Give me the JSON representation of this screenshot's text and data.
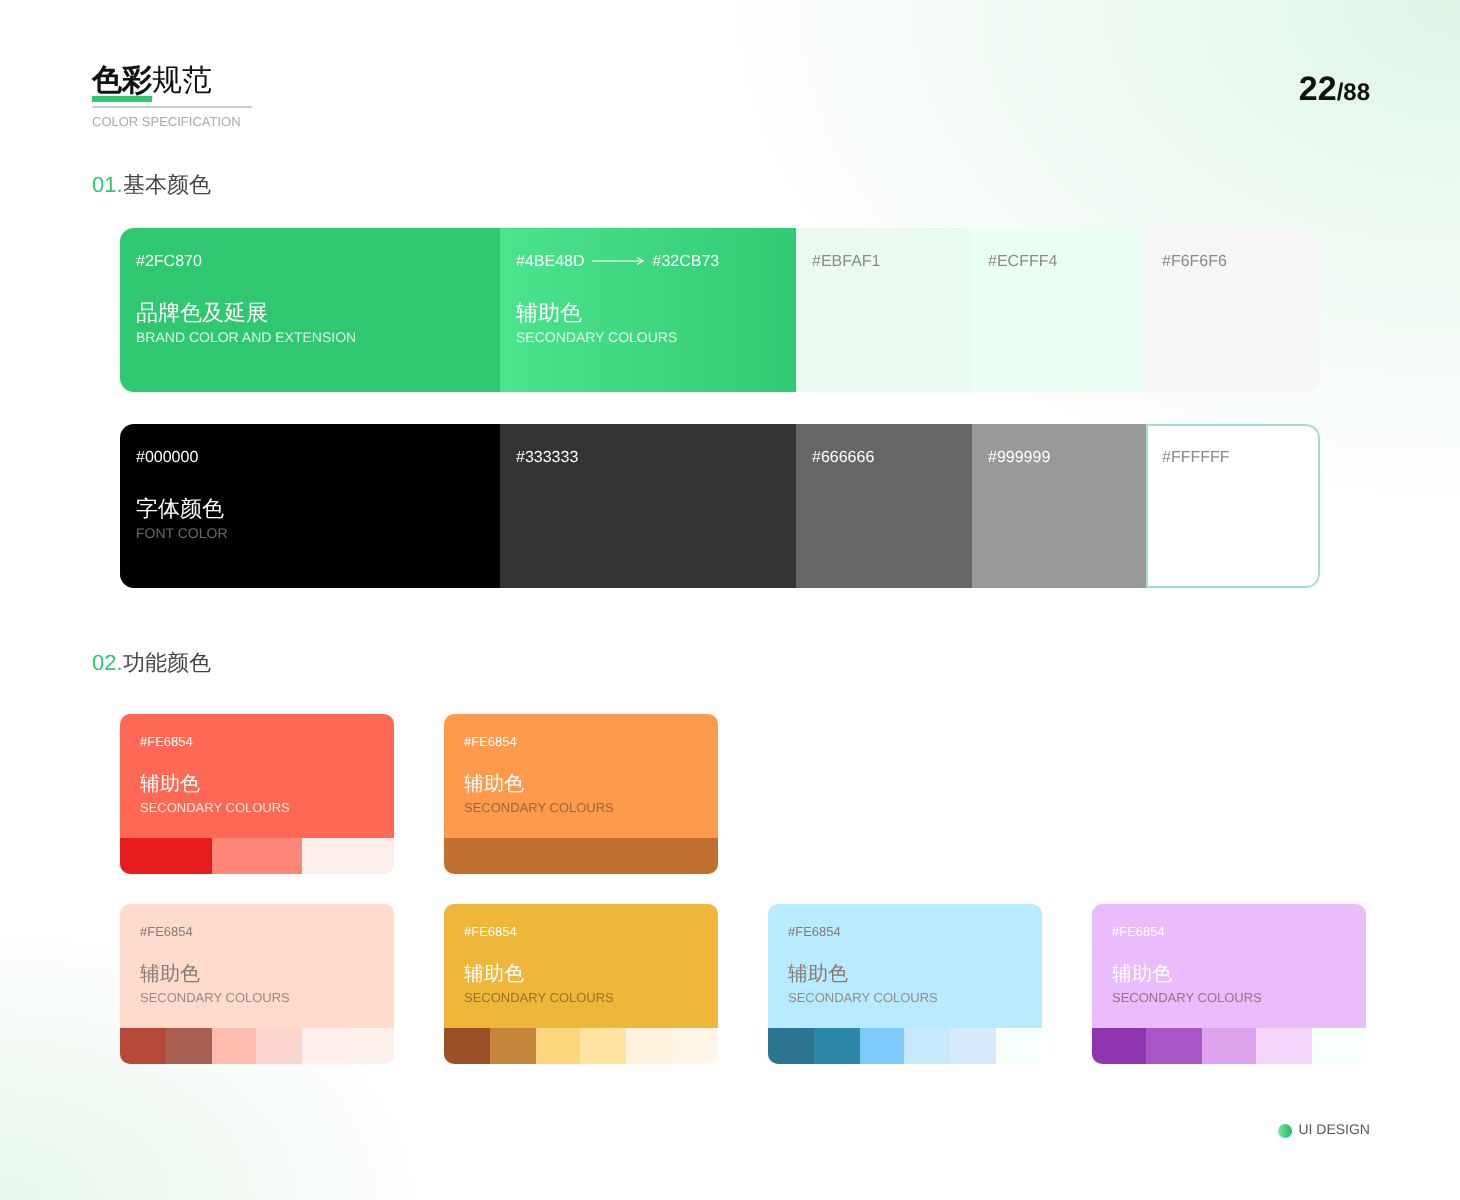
{
  "header": {
    "title_bold": "色彩",
    "title_rest": "规范",
    "subtitle": "COLOR SPECIFICATION",
    "page_current": "22",
    "page_total": "/88"
  },
  "basic": {
    "number": "01.",
    "title": "基本颜色",
    "rows": [
      {
        "segments": [
          {
            "color": "#2FC870",
            "hex": "#2FC870",
            "title": "品牌色及延展",
            "subtitle": "BRAND COLOR AND EXTENSION"
          },
          {
            "color": "#4BE48D",
            "hex": "#4BE48D",
            "hex_to": "#32CB73",
            "title": "辅助色",
            "subtitle": "SECONDARY COLOURS"
          },
          {
            "color": "#EBFAF1",
            "hex": "#EBFAF1"
          },
          {
            "color": "#ECFFF4",
            "hex": "#ECFFF4"
          },
          {
            "color": "#F6F6F6",
            "hex": "#F6F6F6"
          }
        ]
      },
      {
        "segments": [
          {
            "color": "#000000",
            "hex": "#000000",
            "title": "字体颜色",
            "subtitle": "FONT COLOR"
          },
          {
            "color": "#333333",
            "hex": "#333333"
          },
          {
            "color": "#666666",
            "hex": "#666666"
          },
          {
            "color": "#999999",
            "hex": "#999999"
          },
          {
            "color": "#FFFFFF",
            "hex": "#FFFFFF",
            "outlined": true
          }
        ]
      }
    ]
  },
  "functional": {
    "number": "02.",
    "title": "功能颜色",
    "rows": [
      {
        "cards": [
          {
            "color": "#fe6854",
            "hex": "#FE6854",
            "title": "辅助色",
            "subtitle": "SECONDARY COLOURS",
            "shades": [
              {
                "color": "#e81c1c"
              },
              {
                "color": "#ff8777"
              },
              {
                "color": "#fdeeeb"
              }
            ]
          },
          {
            "color": "#fd9a4c",
            "hex": "#FE6854",
            "title": "辅助色",
            "subtitle": "SECONDARY COLOURS",
            "shades": [
              {
                "color": "#c0712f"
              }
            ]
          }
        ]
      },
      {
        "cards": [
          {
            "color": "#ffdbcc",
            "hex": "#FE6854",
            "title": "辅助色",
            "subtitle": "SECONDARY COLOURS",
            "shades": [
              {
                "color": "#b5493a"
              },
              {
                "color": "#a85e50"
              },
              {
                "color": "#fdbcad"
              },
              {
                "color": "#fbd6ce"
              },
              {
                "color": "#fdeeeb"
              },
              {
                "color": "#fbf0ea"
              }
            ]
          },
          {
            "color": "#efb73a",
            "hex": "#FE6854",
            "title": "辅助色",
            "subtitle": "SECONDARY COLOURS",
            "shades": [
              {
                "color": "#9c5028"
              },
              {
                "color": "#c4853b"
              },
              {
                "color": "#fed67e"
              },
              {
                "color": "#fee59f"
              },
              {
                "color": "#fff3dd"
              },
              {
                "color": "#fff6e8"
              }
            ]
          },
          {
            "color": "#b8ebff",
            "hex": "#FE6854",
            "title": "辅助色",
            "subtitle": "SECONDARY COLOURS",
            "shades": [
              {
                "color": "#2b7590"
              },
              {
                "color": "#2c87a8"
              },
              {
                "color": "#7fcafd"
              },
              {
                "color": "#c6e9fe"
              },
              {
                "color": "#d6ecfe"
              },
              {
                "color": "#f9fffb"
              }
            ]
          },
          {
            "color": "#eabcfc",
            "hex": "#FE6854",
            "title": "辅助色",
            "subtitle": "SECONDARY COLOURS",
            "shades": [
              {
                "color": "#8f34b0"
              },
              {
                "color": "#a855c8"
              },
              {
                "color": "#dea3ee"
              },
              {
                "color": "#f6d5fd"
              },
              {
                "color": "#f9fffb"
              }
            ]
          }
        ]
      }
    ]
  },
  "footer": {
    "label": "UI DESIGN"
  }
}
